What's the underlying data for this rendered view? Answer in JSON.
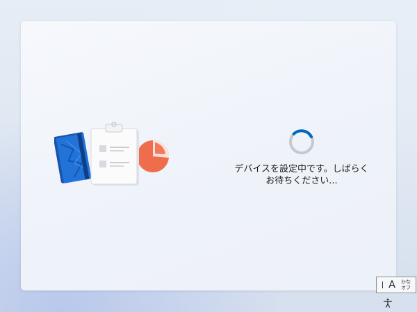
{
  "status": {
    "line1": "デバイスを設定中です。しばらく",
    "line2": "お待ちください..."
  },
  "ime": {
    "mode": "A",
    "kana_line1": "かな",
    "kana_line2": "オフ"
  },
  "icons": {
    "illustration": "setup-illustration",
    "spinner": "loading-spinner-icon",
    "accessibility": "accessibility-icon"
  },
  "colors": {
    "spinner_track": "#c4c8cf",
    "spinner_arc": "#0067c0",
    "book": "#1e63c2",
    "chart": "#ef6c4c"
  }
}
